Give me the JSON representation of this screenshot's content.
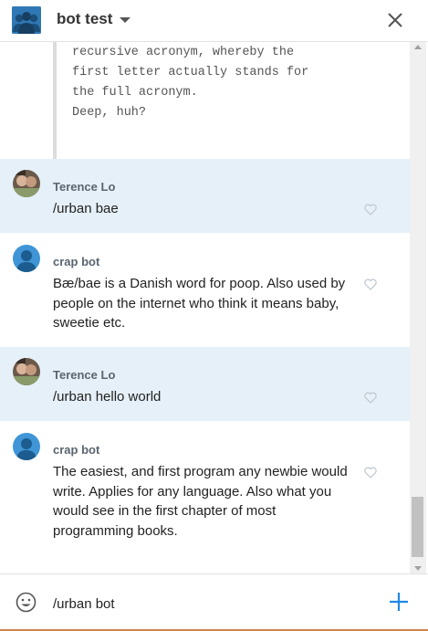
{
  "header": {
    "title": "bot test",
    "group_icon": "group-avatar-icon",
    "dropdown_icon": "caret-down-icon",
    "close_icon": "close-icon"
  },
  "quote": {
    "lines": [
      "recursive acronym, whereby the",
      "first letter actually stands for",
      "the full acronym.",
      "",
      "Deep, huh?"
    ]
  },
  "messages": [
    {
      "author": "Terence Lo",
      "text": "/urban bae",
      "highlighted": true
    },
    {
      "author": "crap bot",
      "text": "Bæ/bae is a Danish word for poop. Also used by people on the internet who think it means baby, sweetie etc.",
      "highlighted": false
    },
    {
      "author": "Terence Lo",
      "text": "/urban hello world",
      "highlighted": true
    },
    {
      "author": "crap bot",
      "text": "The easiest, and first program any newbie would write. Applies for any language. Also what you would see in the first chapter of most programming books.",
      "highlighted": false
    }
  ],
  "composer": {
    "value": "/urban bot",
    "emoji_icon": "smiley-icon",
    "send_icon": "plus-icon"
  },
  "colors": {
    "accent": "#1e88e5",
    "highlight_bg": "#e6f0f8",
    "author": "#5a6570"
  }
}
